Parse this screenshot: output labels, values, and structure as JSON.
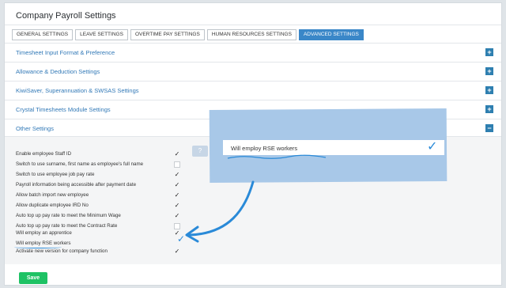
{
  "page": {
    "title": "Company Payroll Settings"
  },
  "tabs": [
    {
      "label": "GENERAL SETTINGS"
    },
    {
      "label": "LEAVE SETTINGS"
    },
    {
      "label": "OVERTIME PAY SETTINGS"
    },
    {
      "label": "HUMAN RESOURCES SETTINGS"
    },
    {
      "label": "ADVANCED SETTINGS"
    }
  ],
  "active_tab": "ADVANCED SETTINGS",
  "sections": [
    {
      "title": "Timesheet Input Format & Preference",
      "toggle": "+"
    },
    {
      "title": "Allowance & Deduction Settings",
      "toggle": "+"
    },
    {
      "title": "KiwiSaver, Superannuation & SWSAS Settings",
      "toggle": "+"
    },
    {
      "title": "Crystal Timesheets Module Settings",
      "toggle": "+"
    },
    {
      "title": "Other Settings",
      "toggle": "−"
    }
  ],
  "settings": [
    {
      "label": "Enable employee Staff ID",
      "checked": true
    },
    {
      "label": "Switch to use surname, first name as employee's full name",
      "checked": false
    },
    {
      "label": "Switch to use employee job pay rate",
      "checked": true
    },
    {
      "label": "Payroll information being accessible after payment date",
      "checked": true
    },
    {
      "label": "Allow batch import new employee",
      "checked": true
    },
    {
      "label": "Allow duplicate employee IRD No",
      "checked": true
    },
    {
      "label": "Auto top up pay rate to meet the Minimum Wage",
      "checked": true
    },
    {
      "label": "Auto top up pay rate to meet the Contract Rate",
      "checked": false
    },
    {
      "label": "Will employ an apprentice",
      "checked": true
    },
    {
      "label": "Will employ RSE workers",
      "checked": true
    },
    {
      "label": "Activate new version for company function",
      "checked": true
    }
  ],
  "annotation": {
    "zoom_label": "Will employ RSE workers",
    "check_glyph": "✓",
    "accent_color": "#2a8ad8",
    "highlight_color": "#a8c8e8"
  },
  "help_icon": "?",
  "save_label": "Save",
  "colors": {
    "tab_active": "#3a87c8",
    "section_title": "#3279b7",
    "toggle_button": "#2e7fb0",
    "save_button": "#1ec264"
  }
}
